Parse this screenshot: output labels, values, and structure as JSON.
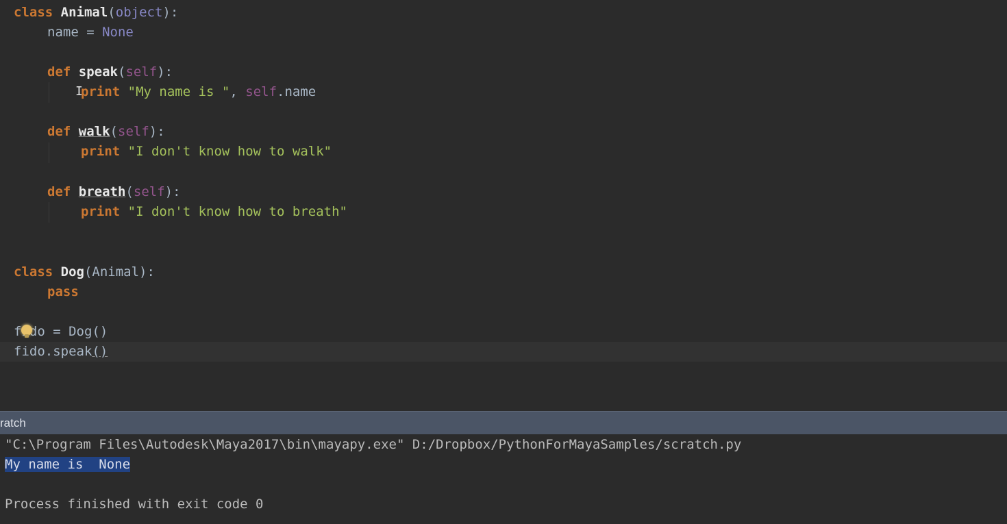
{
  "editor": {
    "lines": {
      "l1": {
        "kw": "class",
        "name": "Animal",
        "paren_open": "(",
        "base": "object",
        "paren_close": "):"
      },
      "l2": {
        "var": "name",
        "op": " = ",
        "val": "None"
      },
      "l4": {
        "kw": "def",
        "name": "speak",
        "po": "(",
        "self": "self",
        "pc": "):"
      },
      "l5": {
        "kw": "print",
        "str": "\"My name is \"",
        "sep": ", ",
        "self": "self",
        "attr": ".name"
      },
      "l7": {
        "kw": "def",
        "name": "walk",
        "po": "(",
        "self": "self",
        "pc": "):"
      },
      "l8": {
        "kw": "print",
        "str": "\"I don't know how to walk\""
      },
      "l10": {
        "kw": "def",
        "name": "breath",
        "po": "(",
        "self": "self",
        "pc": "):"
      },
      "l11": {
        "kw": "print",
        "str": "\"I don't know how to breath\""
      },
      "l14": {
        "kw": "class",
        "name": "Dog",
        "rest": "(Animal):"
      },
      "l15": {
        "kw": "pass"
      },
      "l17": {
        "text": "fido = Dog()"
      },
      "l18": {
        "text": "fido.speak",
        "parens": "()"
      }
    }
  },
  "run_panel": {
    "title": "ratch",
    "output": {
      "command": "\"C:\\Program Files\\Autodesk\\Maya2017\\bin\\mayapy.exe\" D:/Dropbox/PythonForMayaSamples/scratch.py",
      "result": "My name is  None",
      "exit": "Process finished with exit code 0"
    }
  },
  "colors": {
    "keyword": "#cc7832",
    "string": "#a5c25c",
    "self": "#94558d",
    "builtin": "#8888c6",
    "background": "#2b2b2b",
    "run_header": "#4b5566",
    "selection": "#214283"
  }
}
